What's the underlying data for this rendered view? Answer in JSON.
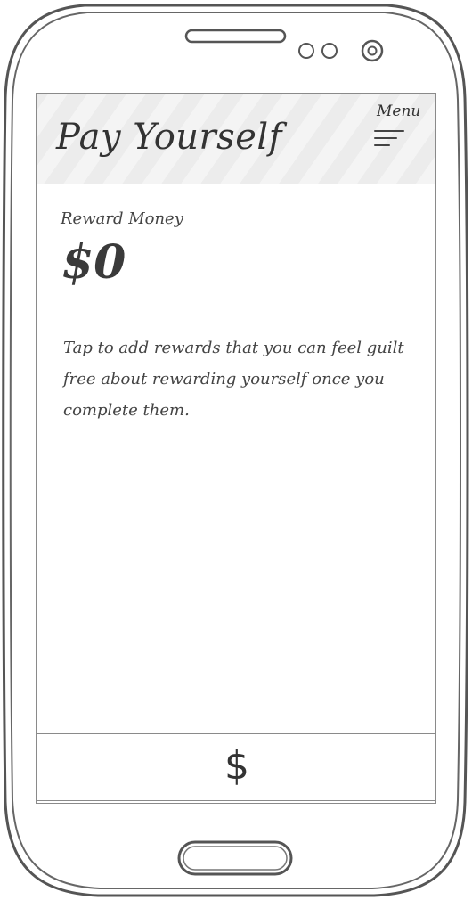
{
  "app": {
    "title": "Pay Yourself",
    "menu_label": "Menu"
  },
  "reward": {
    "label": "Reward Money",
    "amount": "$0"
  },
  "description": "Tap to add rewards that you can feel guilt free about rewarding yourself once you complete them.",
  "bottom_bar": {
    "add_reward_symbol": "$"
  },
  "icons": {
    "menu": "hamburger-menu-icon",
    "speaker": "speaker-slot-icon",
    "sensors": "sensor-icon",
    "camera": "front-camera-icon",
    "home": "home-button-icon"
  },
  "colors": {
    "frame": "#555555",
    "header_bg": "#f4f4f4",
    "text": "#333333"
  }
}
